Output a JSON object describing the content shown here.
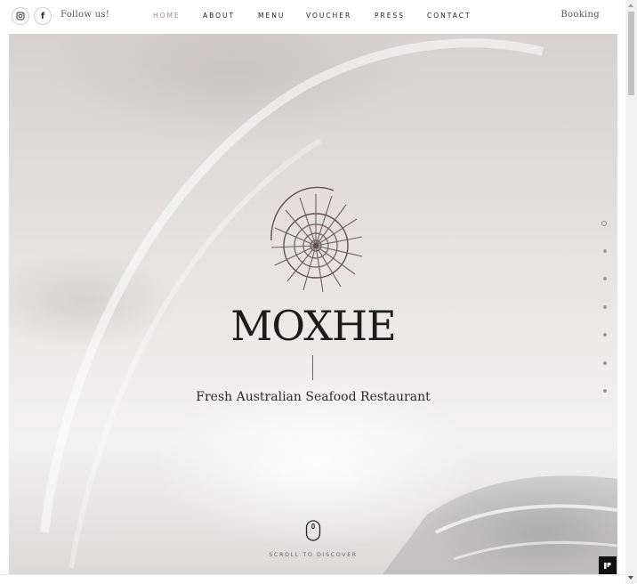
{
  "header": {
    "social": [
      {
        "name": "instagram-icon"
      },
      {
        "name": "facebook-icon",
        "glyph": "f"
      }
    ],
    "follow_label": "Follow us!",
    "nav": [
      {
        "label": "HOME",
        "active": true
      },
      {
        "label": "ABOUT",
        "active": false
      },
      {
        "label": "MENU",
        "active": false
      },
      {
        "label": "VOUCHER",
        "active": false
      },
      {
        "label": "PRESS",
        "active": false
      },
      {
        "label": "CONTACT",
        "active": false
      }
    ],
    "booking_label": "Booking"
  },
  "hero": {
    "title": "MOXHE",
    "subtitle": "Fresh Australian Seafood Restaurant",
    "scroll_label": "SCROLL TO DISCOVER",
    "logo_icon": "nautilus-shell-icon",
    "mouse_icon": "mouse-scroll-icon",
    "section_dots": 7,
    "active_dot": 0
  },
  "colors": {
    "nav_active": "#9b8a8c",
    "text": "#1c1c1c",
    "corner_button": "#111111"
  }
}
